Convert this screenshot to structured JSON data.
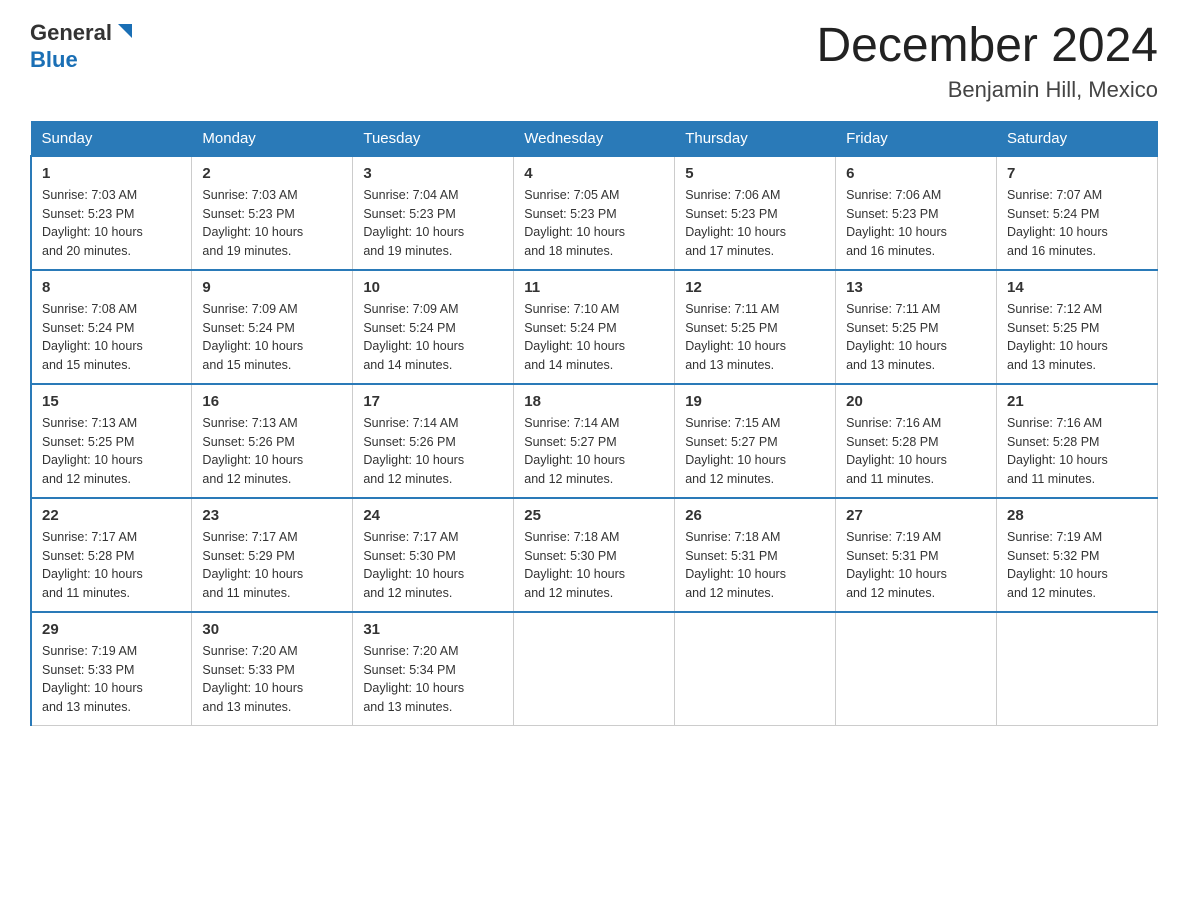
{
  "header": {
    "logo_line1": "General",
    "logo_line2": "Blue",
    "title": "December 2024",
    "subtitle": "Benjamin Hill, Mexico"
  },
  "days_of_week": [
    "Sunday",
    "Monday",
    "Tuesday",
    "Wednesday",
    "Thursday",
    "Friday",
    "Saturday"
  ],
  "weeks": [
    [
      {
        "day": "1",
        "sunrise": "7:03 AM",
        "sunset": "5:23 PM",
        "daylight": "10 hours and 20 minutes."
      },
      {
        "day": "2",
        "sunrise": "7:03 AM",
        "sunset": "5:23 PM",
        "daylight": "10 hours and 19 minutes."
      },
      {
        "day": "3",
        "sunrise": "7:04 AM",
        "sunset": "5:23 PM",
        "daylight": "10 hours and 19 minutes."
      },
      {
        "day": "4",
        "sunrise": "7:05 AM",
        "sunset": "5:23 PM",
        "daylight": "10 hours and 18 minutes."
      },
      {
        "day": "5",
        "sunrise": "7:06 AM",
        "sunset": "5:23 PM",
        "daylight": "10 hours and 17 minutes."
      },
      {
        "day": "6",
        "sunrise": "7:06 AM",
        "sunset": "5:23 PM",
        "daylight": "10 hours and 16 minutes."
      },
      {
        "day": "7",
        "sunrise": "7:07 AM",
        "sunset": "5:24 PM",
        "daylight": "10 hours and 16 minutes."
      }
    ],
    [
      {
        "day": "8",
        "sunrise": "7:08 AM",
        "sunset": "5:24 PM",
        "daylight": "10 hours and 15 minutes."
      },
      {
        "day": "9",
        "sunrise": "7:09 AM",
        "sunset": "5:24 PM",
        "daylight": "10 hours and 15 minutes."
      },
      {
        "day": "10",
        "sunrise": "7:09 AM",
        "sunset": "5:24 PM",
        "daylight": "10 hours and 14 minutes."
      },
      {
        "day": "11",
        "sunrise": "7:10 AM",
        "sunset": "5:24 PM",
        "daylight": "10 hours and 14 minutes."
      },
      {
        "day": "12",
        "sunrise": "7:11 AM",
        "sunset": "5:25 PM",
        "daylight": "10 hours and 13 minutes."
      },
      {
        "day": "13",
        "sunrise": "7:11 AM",
        "sunset": "5:25 PM",
        "daylight": "10 hours and 13 minutes."
      },
      {
        "day": "14",
        "sunrise": "7:12 AM",
        "sunset": "5:25 PM",
        "daylight": "10 hours and 13 minutes."
      }
    ],
    [
      {
        "day": "15",
        "sunrise": "7:13 AM",
        "sunset": "5:25 PM",
        "daylight": "10 hours and 12 minutes."
      },
      {
        "day": "16",
        "sunrise": "7:13 AM",
        "sunset": "5:26 PM",
        "daylight": "10 hours and 12 minutes."
      },
      {
        "day": "17",
        "sunrise": "7:14 AM",
        "sunset": "5:26 PM",
        "daylight": "10 hours and 12 minutes."
      },
      {
        "day": "18",
        "sunrise": "7:14 AM",
        "sunset": "5:27 PM",
        "daylight": "10 hours and 12 minutes."
      },
      {
        "day": "19",
        "sunrise": "7:15 AM",
        "sunset": "5:27 PM",
        "daylight": "10 hours and 12 minutes."
      },
      {
        "day": "20",
        "sunrise": "7:16 AM",
        "sunset": "5:28 PM",
        "daylight": "10 hours and 11 minutes."
      },
      {
        "day": "21",
        "sunrise": "7:16 AM",
        "sunset": "5:28 PM",
        "daylight": "10 hours and 11 minutes."
      }
    ],
    [
      {
        "day": "22",
        "sunrise": "7:17 AM",
        "sunset": "5:28 PM",
        "daylight": "10 hours and 11 minutes."
      },
      {
        "day": "23",
        "sunrise": "7:17 AM",
        "sunset": "5:29 PM",
        "daylight": "10 hours and 11 minutes."
      },
      {
        "day": "24",
        "sunrise": "7:17 AM",
        "sunset": "5:30 PM",
        "daylight": "10 hours and 12 minutes."
      },
      {
        "day": "25",
        "sunrise": "7:18 AM",
        "sunset": "5:30 PM",
        "daylight": "10 hours and 12 minutes."
      },
      {
        "day": "26",
        "sunrise": "7:18 AM",
        "sunset": "5:31 PM",
        "daylight": "10 hours and 12 minutes."
      },
      {
        "day": "27",
        "sunrise": "7:19 AM",
        "sunset": "5:31 PM",
        "daylight": "10 hours and 12 minutes."
      },
      {
        "day": "28",
        "sunrise": "7:19 AM",
        "sunset": "5:32 PM",
        "daylight": "10 hours and 12 minutes."
      }
    ],
    [
      {
        "day": "29",
        "sunrise": "7:19 AM",
        "sunset": "5:33 PM",
        "daylight": "10 hours and 13 minutes."
      },
      {
        "day": "30",
        "sunrise": "7:20 AM",
        "sunset": "5:33 PM",
        "daylight": "10 hours and 13 minutes."
      },
      {
        "day": "31",
        "sunrise": "7:20 AM",
        "sunset": "5:34 PM",
        "daylight": "10 hours and 13 minutes."
      },
      null,
      null,
      null,
      null
    ]
  ],
  "labels": {
    "sunrise": "Sunrise:",
    "sunset": "Sunset:",
    "daylight": "Daylight:"
  }
}
